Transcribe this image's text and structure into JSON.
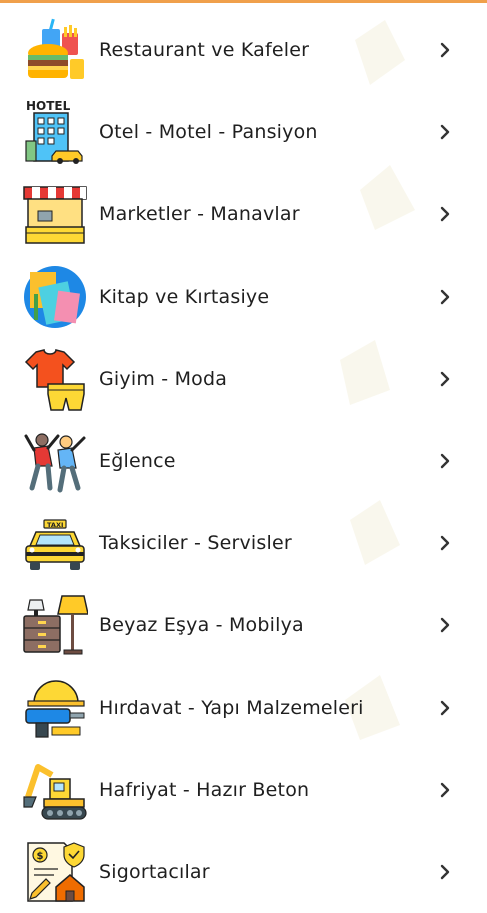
{
  "header": {
    "accent_color": "#f0a04b"
  },
  "categories": [
    {
      "label": "Restaurant ve Kafeler",
      "icon": "burger-fries-drink-icon"
    },
    {
      "label": "Otel - Motel - Pansiyon",
      "icon": "hotel-building-icon",
      "icon_text": "HOTEL"
    },
    {
      "label": "Marketler - Manavlar",
      "icon": "market-stall-icon"
    },
    {
      "label": "Kitap ve Kırtasiye",
      "icon": "books-stationery-icon"
    },
    {
      "label": "Giyim - Moda",
      "icon": "clothes-icon"
    },
    {
      "label": "Eğlence",
      "icon": "dancing-people-icon"
    },
    {
      "label": "Taksiciler - Servisler",
      "icon": "taxi-icon",
      "icon_text": "TAXI"
    },
    {
      "label": "Beyaz Eşya - Mobilya",
      "icon": "furniture-lamp-icon"
    },
    {
      "label": "Hırdavat - Yapı Malzemeleri",
      "icon": "drill-helmet-icon"
    },
    {
      "label": "Hafriyat - Hazır Beton",
      "icon": "excavator-icon"
    },
    {
      "label": "Sigortacılar",
      "icon": "insurance-document-icon"
    }
  ],
  "colors": {
    "text": "#1f1f1f",
    "chevron": "#333333"
  }
}
